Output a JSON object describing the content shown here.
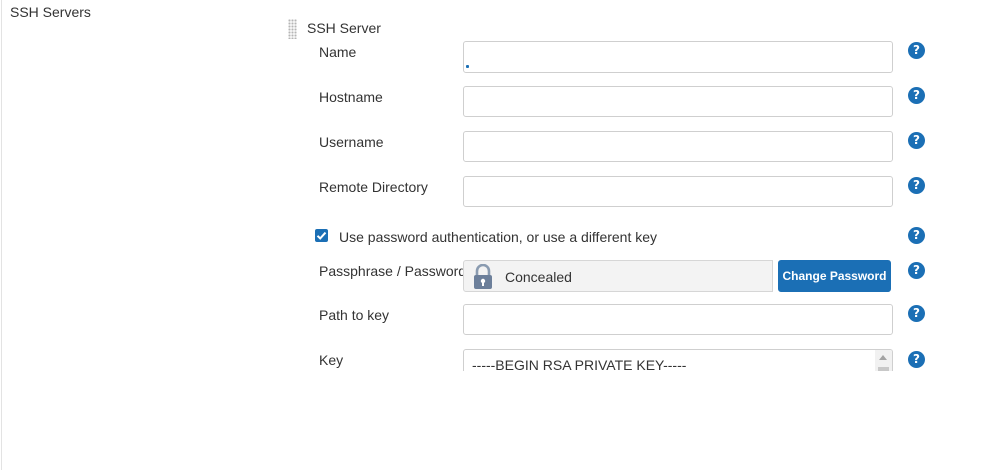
{
  "section": {
    "title": "SSH Servers"
  },
  "server": {
    "title": "SSH Server",
    "fields": {
      "name": {
        "label": "Name",
        "value": ""
      },
      "hostname": {
        "label": "Hostname",
        "value": ""
      },
      "username": {
        "label": "Username",
        "value": ""
      },
      "remote_directory": {
        "label": "Remote Directory",
        "value": ""
      }
    },
    "password_auth": {
      "label": "Use password authentication, or use a different key",
      "checked": true
    },
    "passphrase": {
      "label": "Passphrase / Password",
      "status": "Concealed",
      "button": "Change Password"
    },
    "path_to_key": {
      "label": "Path to key",
      "value": ""
    },
    "key": {
      "label": "Key",
      "value": "-----BEGIN RSA PRIVATE KEY-----"
    }
  },
  "help_glyph": "?",
  "colors": {
    "accent": "#1b6fb5",
    "text": "#333333",
    "border": "#cfcfcf",
    "concealed_bg": "#f3f3f3"
  },
  "icons": [
    "drag-handle-icon",
    "help-icon",
    "lock-icon",
    "checkbox-checked-icon"
  ]
}
